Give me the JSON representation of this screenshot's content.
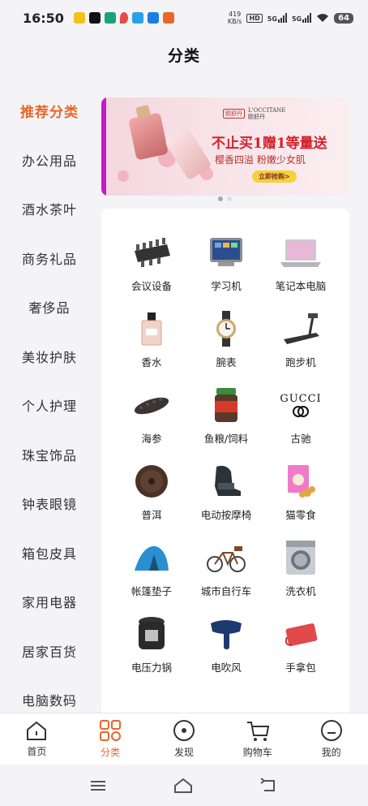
{
  "status_bar": {
    "time": "16:50",
    "net_speed_value": "419",
    "net_speed_unit": "KB/s",
    "hd_label": "HD",
    "sim1": "5G",
    "sim2": "5G",
    "battery": "64"
  },
  "header": {
    "title": "分类"
  },
  "sidebar": {
    "items": [
      {
        "label": "推荐分类",
        "active": true
      },
      {
        "label": "办公用品"
      },
      {
        "label": "酒水茶叶"
      },
      {
        "label": "商务礼品"
      },
      {
        "label": "奢侈品"
      },
      {
        "label": "美妆护肤"
      },
      {
        "label": "个人护理"
      },
      {
        "label": "珠宝饰品"
      },
      {
        "label": "钟表眼镜"
      },
      {
        "label": "箱包皮具"
      },
      {
        "label": "家用电器"
      },
      {
        "label": "居家百货"
      },
      {
        "label": "电脑数码"
      }
    ]
  },
  "banner": {
    "badge": "欧舒丹",
    "logo_text": "L'OCCITANE",
    "brand": "欧舒丹",
    "headline": "不止买1赠1等量送",
    "subline": "樱香四溢 粉嫩少女肌",
    "button": "立即抢购>",
    "colors": {
      "accent": "#d2222a",
      "button_bg": "#f2d23d",
      "edge": "#c41cc8"
    }
  },
  "products": [
    {
      "label": "会议设备",
      "icon": "conference-table-icon"
    },
    {
      "label": "学习机",
      "icon": "tablet-icon"
    },
    {
      "label": "笔记本电脑",
      "icon": "laptop-icon"
    },
    {
      "label": "香水",
      "icon": "perfume-icon"
    },
    {
      "label": "腕表",
      "icon": "watch-icon"
    },
    {
      "label": "跑步机",
      "icon": "treadmill-icon"
    },
    {
      "label": "海参",
      "icon": "sea-cucumber-icon"
    },
    {
      "label": "鱼粮/饲料",
      "icon": "fish-food-jar-icon"
    },
    {
      "label": "古驰",
      "icon": "gucci-logo-icon",
      "logo_text": "GUCCI"
    },
    {
      "label": "普洱",
      "icon": "puer-tea-cake-icon"
    },
    {
      "label": "电动按摩椅",
      "icon": "massage-chair-icon"
    },
    {
      "label": "猫零食",
      "icon": "cat-snack-icon"
    },
    {
      "label": "帐篷垫子",
      "icon": "tent-icon"
    },
    {
      "label": "城市自行车",
      "icon": "bicycle-icon"
    },
    {
      "label": "洗衣机",
      "icon": "washing-machine-icon"
    },
    {
      "label": "电压力锅",
      "icon": "pressure-cooker-icon"
    },
    {
      "label": "电吹风",
      "icon": "hair-dryer-icon"
    },
    {
      "label": "手拿包",
      "icon": "clutch-bag-icon"
    }
  ],
  "bottom_nav": [
    {
      "label": "首页",
      "icon": "home-icon"
    },
    {
      "label": "分类",
      "icon": "category-grid-icon",
      "active": true
    },
    {
      "label": "发现",
      "icon": "discover-icon"
    },
    {
      "label": "购物车",
      "icon": "cart-icon"
    },
    {
      "label": "我的",
      "icon": "profile-icon"
    }
  ],
  "colors": {
    "accent": "#e8662b",
    "background": "#f4f4f6"
  }
}
